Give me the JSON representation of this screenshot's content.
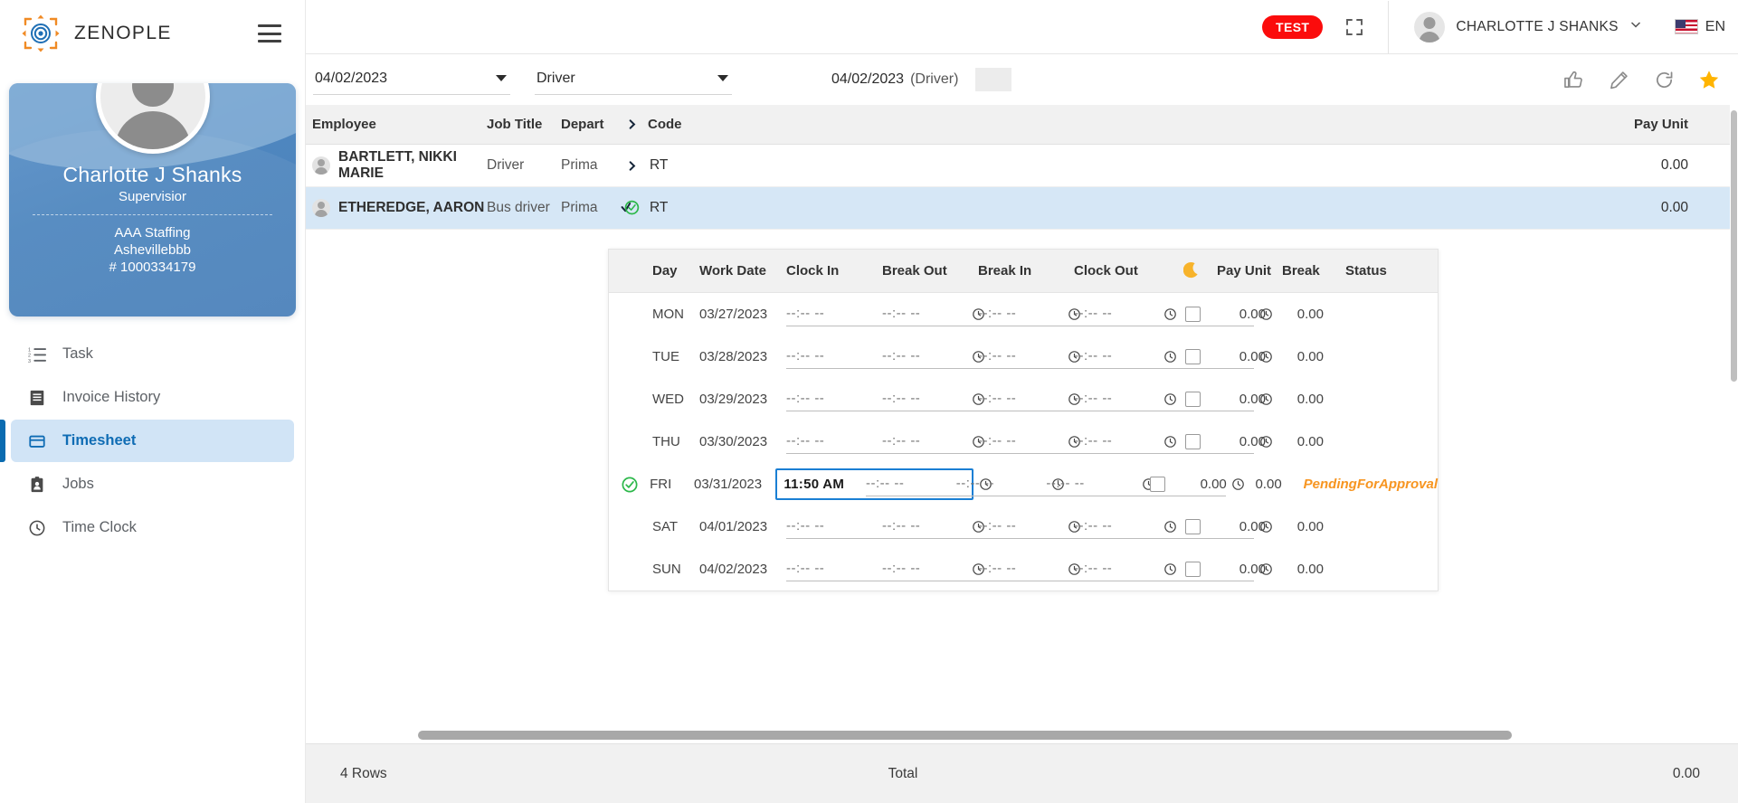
{
  "brand": {
    "name": "ZENOPLE",
    "logo_icon": "zenople-logo-icon",
    "menu_icon": "hamburger-menu-icon"
  },
  "profile": {
    "name": "Charlotte J Shanks",
    "role": "Supervisior",
    "company": "AAA Staffing",
    "branch": "Ashevillebbb",
    "id": "# 1000334179",
    "avatar_icon": "user-avatar-icon"
  },
  "sidebar": {
    "items": [
      {
        "label": "Task",
        "icon": "list-numbered-icon",
        "active": false
      },
      {
        "label": "Invoice History",
        "icon": "invoice-icon",
        "active": false
      },
      {
        "label": "Timesheet",
        "icon": "timesheet-card-icon",
        "active": true
      },
      {
        "label": "Jobs",
        "icon": "clipboard-person-icon",
        "active": false
      },
      {
        "label": "Time Clock",
        "icon": "clock-icon",
        "active": false
      }
    ]
  },
  "header": {
    "test_badge": "TEST",
    "fullscreen_icon": "fullscreen-icon",
    "user_name": "CHARLOTTE J SHANKS",
    "user_chevron_icon": "chevron-down-icon",
    "language": "EN",
    "flag_icon": "us-flag-icon",
    "avatar_icon": "user-avatar-icon"
  },
  "toolbar": {
    "date_filter": "04/02/2023",
    "role_filter": "Driver",
    "context_date": "04/02/2023",
    "context_role": "(Driver)",
    "icons": [
      {
        "name": "thumbs-up-icon",
        "label": "Approve"
      },
      {
        "name": "pencil-edit-icon",
        "label": "Edit"
      },
      {
        "name": "refresh-icon",
        "label": "Refresh"
      },
      {
        "name": "star-icon",
        "label": "Favorite",
        "color": "#ffb400"
      }
    ]
  },
  "employee_table": {
    "columns": [
      "Employee",
      "Job Title",
      "Depart",
      "",
      "Code",
      "Pay Unit"
    ],
    "rows": [
      {
        "employee": "BARTLETT, NIKKI MARIE",
        "job_title": "Driver",
        "department": "Prima",
        "expand_icon": "chevron-right-icon",
        "code": "RT",
        "pay_unit": "0.00",
        "selected": false
      },
      {
        "employee": "ETHEREDGE, AARON",
        "job_title": "Bus driver",
        "department": "Prima",
        "expand_icon": "check-circle-icon",
        "code": "RT",
        "pay_unit": "0.00",
        "selected": true
      }
    ]
  },
  "timesheet_detail": {
    "columns": [
      "Day",
      "Work Date",
      "Clock In",
      "Break Out",
      "Break In",
      "Clock Out",
      "Pay Unit",
      "Break",
      "Status"
    ],
    "moon_icon": "moon-icon",
    "time_placeholder": "--:-- --",
    "clock_icon": "clock-small-icon",
    "rows": [
      {
        "day": "MON",
        "work_date": "03/27/2023",
        "clock_in": "",
        "break_out": "",
        "break_in": "",
        "clock_out": "",
        "night": false,
        "pay_unit": "0.00",
        "break": "0.00",
        "status": "",
        "approved": false,
        "focused": false
      },
      {
        "day": "TUE",
        "work_date": "03/28/2023",
        "clock_in": "",
        "break_out": "",
        "break_in": "",
        "clock_out": "",
        "night": false,
        "pay_unit": "0.00",
        "break": "0.00",
        "status": "",
        "approved": false,
        "focused": false
      },
      {
        "day": "WED",
        "work_date": "03/29/2023",
        "clock_in": "",
        "break_out": "",
        "break_in": "",
        "clock_out": "",
        "night": false,
        "pay_unit": "0.00",
        "break": "0.00",
        "status": "",
        "approved": false,
        "focused": false
      },
      {
        "day": "THU",
        "work_date": "03/30/2023",
        "clock_in": "",
        "break_out": "",
        "break_in": "",
        "clock_out": "",
        "night": false,
        "pay_unit": "0.00",
        "break": "0.00",
        "status": "",
        "approved": false,
        "focused": false
      },
      {
        "day": "FRI",
        "work_date": "03/31/2023",
        "clock_in": "11:50 AM",
        "break_out": "",
        "break_in": "",
        "clock_out": "",
        "night": false,
        "pay_unit": "0.00",
        "break": "0.00",
        "status": "PendingForApproval",
        "approved": true,
        "focused": true
      },
      {
        "day": "SAT",
        "work_date": "04/01/2023",
        "clock_in": "",
        "break_out": "",
        "break_in": "",
        "clock_out": "",
        "night": false,
        "pay_unit": "0.00",
        "break": "0.00",
        "status": "",
        "approved": false,
        "focused": false
      },
      {
        "day": "SUN",
        "work_date": "04/02/2023",
        "clock_in": "",
        "break_out": "",
        "break_in": "",
        "clock_out": "",
        "night": false,
        "pay_unit": "0.00",
        "break": "0.00",
        "status": "",
        "approved": false,
        "focused": false
      }
    ]
  },
  "footer": {
    "rows_label": "4 Rows",
    "total_label": "Total",
    "total_value": "0.00"
  },
  "colors": {
    "accent": "#0a6bb0",
    "sidebar_active_bg": "#d1e4f6",
    "selected_row": "#d6e7f6",
    "test_badge": "#fb0c0c",
    "star": "#ffb400",
    "status_pending": "#f79520",
    "focus_border": "#1a7fd4",
    "check_green": "#2db84b"
  }
}
